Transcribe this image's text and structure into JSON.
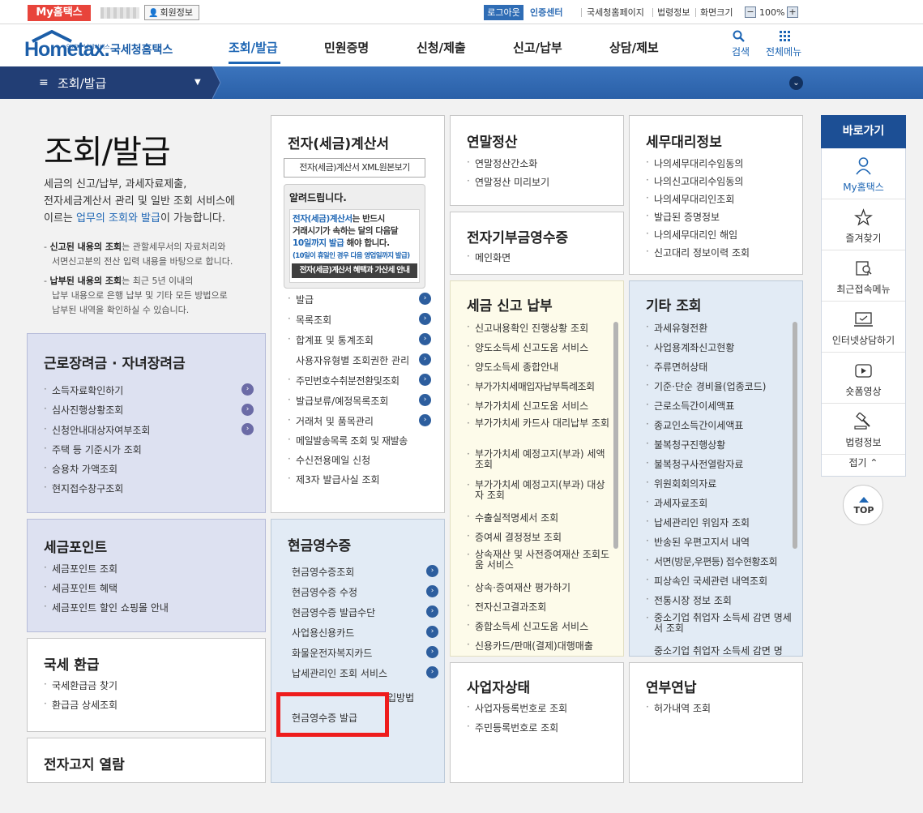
{
  "topbar": {
    "myhome_tab": "My홈택스",
    "member_info": "회원정보",
    "logout": "로그아웃",
    "cert_center": "인증센터",
    "links": [
      "국세청홈페이지",
      "법령정보",
      "화면크기"
    ],
    "zoom_minus": "−",
    "zoom_value": "100%",
    "zoom_plus": "+"
  },
  "header": {
    "logo_word": "Hometax.",
    "logo_sub": "언제나 납세서비스",
    "logo_kr": "국세청홈택스",
    "gnb": [
      "조회/발급",
      "민원증명",
      "신청/제출",
      "신고/납부",
      "상담/제보"
    ],
    "active_gnb": "조회/발급",
    "search_label": "검색",
    "allmenu_label": "전체메뉴"
  },
  "pathbar": {
    "label": "조회/발급",
    "hamburger": "≡",
    "caret": "▼",
    "more": "⌄"
  },
  "intro": {
    "title": "조회/발급",
    "desc_1": "세금의 신고/납부, 과세자료제출,",
    "desc_2": "전자세금계산서 관리 및 일반 조회 서비스에",
    "desc_3a": "이르는 ",
    "desc_3b": "업무의 조회와 발급",
    "desc_3c": "이 가능합니다.",
    "note1_b": "신고된 내용의 조회",
    "note1_t": "는 관할세무서의 자료처리와",
    "note1_2": "서면신고분의 전산 입력 내용을 바탕으로 합니다.",
    "note2_b": "납부된 내용의 조회",
    "note2_t": "는 최근 5년 이내의",
    "note2_2": "납부 내용으로 은행 납부 및 기타 모든 방법으로",
    "note2_3": "납부된 내역을 확인하실 수 있습니다."
  },
  "cards": {
    "labor": {
      "title": "근로장려금 · 자녀장려금",
      "items": [
        "소득자료확인하기",
        "심사진행상황조회",
        "신청안내대상자여부조회",
        "주택 등 기준시가 조회",
        "승용차 가액조회",
        "현지접수창구조회"
      ]
    },
    "point": {
      "title": "세금포인트",
      "items": [
        "세금포인트 조회",
        "세금포인트 혜택",
        "세금포인트 할인 쇼핑몰 안내"
      ]
    },
    "refund": {
      "title": "국세 환급",
      "items": [
        "국세환급금 찾기",
        "환급금 상세조회"
      ]
    },
    "notice": {
      "title": "전자고지 열람"
    },
    "einvoice": {
      "title": "전자(세금)계산서",
      "xml_button": "전자(세금)계산서 XML원본보기",
      "notice_title": "알려드립니다.",
      "notice_l1a": "전자(세금)계산서",
      "notice_l1b": "는 반드시",
      "notice_l2": "거래시기가 속하는 달의 다음달",
      "notice_l3a": "10일까지 발급",
      "notice_l3b": " 해야 합니다.",
      "notice_l4": "(10일이 휴일인 경우 다음 영업일까지 발급)",
      "notice_button": "전자(세금)계산서 혜택과 가산세 안내",
      "items": [
        "발급",
        "목록조회",
        "합계표 및 통계조회",
        "사용자유형별 조회권한 관리",
        "주민번호수취분전환및조회",
        "발급보류/예정목록조회",
        "거래처 및 품목관리",
        "메일발송목록 조회 및 재발송",
        "수신전용메일 신청",
        "제3자 발급사실 조회"
      ]
    },
    "cash": {
      "title": "현금영수증",
      "items": [
        "현금영수증조회",
        "현금영수증 수정",
        "현금영수증 발급수단",
        "사업용신용카드",
        "화물운전자복지카드",
        "납세관리인 조회 서비스"
      ],
      "hidden_tail": "입방법",
      "highlight_item": "현금영수증 발급"
    },
    "yearend": {
      "title": "연말정산",
      "items": [
        "연말정산간소화",
        "연말정산 미리보기"
      ]
    },
    "donation": {
      "title": "전자기부금영수증",
      "items": [
        "메인화면"
      ]
    },
    "taxfile": {
      "title": "세금 신고 납부",
      "items": [
        "신고내용확인 진행상황 조회",
        "양도소득세 신고도움 서비스",
        "양도소득세 종합안내",
        "부가가치세매입자납부특례조회",
        "부가가치세 신고도움 서비스",
        "부가가치세 카드사 대리납부 조회",
        "부가가치세 예정고지(부과) 세액조회",
        "부가가치세 예정고지(부과) 대상자 조회",
        "수출실적명세서 조회",
        "증여세 결정정보 조회",
        "상속재산 및 사전증여재산 조회도움 서비스",
        "상속·증여재산 평가하기",
        "전자신고결과조회",
        "종합소득세 신고도움 서비스",
        "신용카드/판매(결제)대행매출"
      ]
    },
    "bizstatus": {
      "title": "사업자상태",
      "items": [
        "사업자등록번호로 조회",
        "주민등록번호로 조회"
      ]
    },
    "agent": {
      "title": "세무대리정보",
      "items": [
        "나의세무대리수임동의",
        "나의신고대리수임동의",
        "나의세무대리인조회",
        "발급된 증명정보",
        "나의세무대리인 해임",
        "신고대리 정보이력 조회"
      ]
    },
    "etc": {
      "title": "기타 조회",
      "items": [
        "과세유형전환",
        "사업용계좌신고현황",
        "주류면허상태",
        "기준·단순 경비율(업종코드)",
        "근로소득간이세액표",
        "종교인소득간이세액표",
        "불복청구진행상황",
        "불복청구사전열람자료",
        "위원회회의자료",
        "과세자료조회",
        "납세관리인 위임자 조회",
        "반송된 우편고지서 내역",
        "서면(방문,우편등) 접수현황조회",
        "피상속인 국세관련 내역조회",
        "전통시장 정보 조회",
        "중소기업 취업자 소득세 감면 명세서 조회",
        "중소기업 취업자 소득세 감면 명"
      ]
    },
    "annual": {
      "title": "연부연납",
      "items": [
        "허가내역 조회"
      ]
    }
  },
  "quick": {
    "title": "바로가기",
    "items": [
      {
        "label": "My홈택스",
        "icon": "person-icon"
      },
      {
        "label": "즐겨찾기",
        "icon": "star-icon"
      },
      {
        "label": "최근접속메뉴",
        "icon": "recent-icon"
      },
      {
        "label": "인터넷상담하기",
        "icon": "monitor-chat-icon"
      },
      {
        "label": "숏폼영상",
        "icon": "video-icon"
      },
      {
        "label": "법령정보",
        "icon": "gavel-icon"
      }
    ],
    "collapse": "접기 ⌃",
    "top": "TOP"
  },
  "colors": {
    "brand_blue": "#1e66b4",
    "path_dark": "#223e75",
    "highlight_red": "#ee1c1c"
  }
}
